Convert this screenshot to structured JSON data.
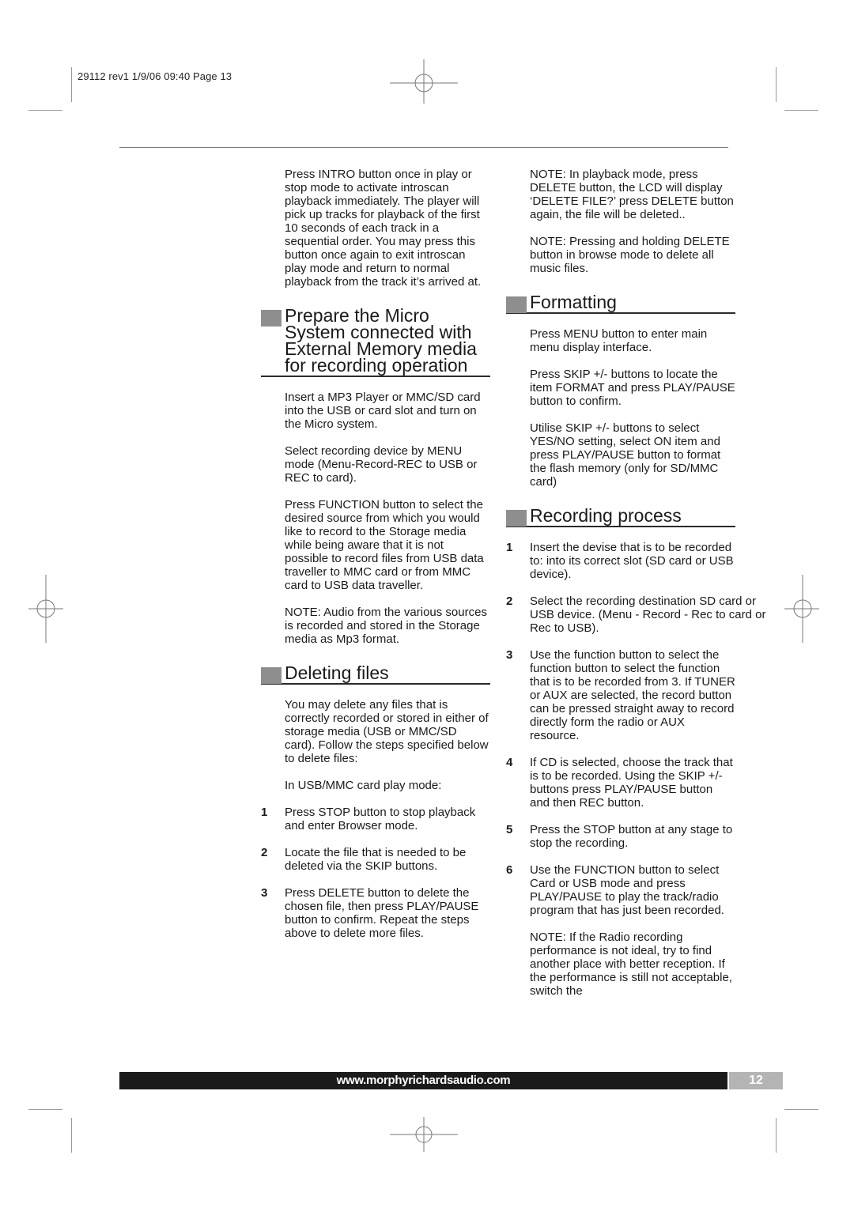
{
  "slug": "29112 rev1  1/9/06  09:40  Page 13",
  "colors": {
    "heading_square": "#8e8e8e",
    "footer_bar": "#1b1b1b",
    "footer_page_box": "#b4b4b4"
  },
  "left_column": {
    "intro_paragraph": "Press INTRO button once in play or stop mode to activate introscan playback immediately. The player will pick up tracks for playback of the first 10 seconds of each track in a sequential order. You may press this button once again to exit introscan play mode and return to normal playback from the track it’s arrived at.",
    "prepare_section": {
      "heading": "Prepare the Micro System connected with External Memory media for recording operation",
      "paragraphs": [
        "Insert a MP3 Player or MMC/SD card into the USB or card slot and turn on the Micro system.",
        "Select recording device by MENU mode (Menu-Record-REC to USB or REC to card).",
        "Press FUNCTION button to select the desired source from which you would like to record to the Storage media  while being aware that it is not possible to record files from USB data traveller to MMC card or from MMC card to USB data traveller.",
        "NOTE: Audio from the various sources is recorded and stored in the Storage media as Mp3 format."
      ]
    },
    "deleting_section": {
      "heading": "Deleting files",
      "paragraphs": [
        "You may delete any files that is correctly recorded or stored in either of storage media (USB or MMC/SD card). Follow  the steps specified below to delete files:",
        "In USB/MMC card play mode:"
      ],
      "steps": [
        {
          "num": "1",
          "text": "Press STOP button to stop playback and enter Browser mode."
        },
        {
          "num": "2",
          "text": "Locate the file that is needed to be deleted via the  SKIP buttons."
        },
        {
          "num": "3",
          "text": "Press DELETE button to delete the chosen file, then press PLAY/PAUSE button to confirm. Repeat the steps above to delete more files."
        }
      ]
    }
  },
  "right_column": {
    "notes": [
      "NOTE: In playback mode, press DELETE button, the LCD will display ‘DELETE FILE?’ press DELETE button again, the file will be deleted..",
      "NOTE: Pressing and holding DELETE button in browse mode to delete all music files."
    ],
    "formatting_section": {
      "heading": "Formatting",
      "paragraphs": [
        "Press MENU button to enter main menu display interface.",
        "Press SKIP +/- buttons to locate the item FORMAT and press PLAY/PAUSE button to confirm.",
        "Utilise SKIP +/- buttons to select YES/NO setting, select ON item and press PLAY/PAUSE button to format the flash memory (only for SD/MMC card)"
      ]
    },
    "recording_section": {
      "heading": "Recording process",
      "steps": [
        {
          "num": "1",
          "text": "Insert the devise that is to be recorded to: into its correct slot (SD card or USB device)."
        },
        {
          "num": "2",
          "text": "Select the recording destination SD card or USB device. (Menu - Record - Rec to card  or Rec to USB)."
        },
        {
          "num": "3",
          "text": "Use the function button to select the function button to select the function that is to be recorded from 3. If TUNER or AUX are selected, the record button can be pressed straight away to record directly form the radio or AUX resource."
        },
        {
          "num": "4",
          "text": "If CD is selected, choose the track that is to be recorded. Using the SKIP +/- buttons press PLAY/PAUSE button and then REC button."
        },
        {
          "num": "5",
          "text": "Press the STOP button at any stage to stop the recording."
        },
        {
          "num": "6",
          "text": "Use the FUNCTION button to select Card or USB mode and press PLAY/PAUSE to play the track/radio program that has just been recorded."
        }
      ],
      "closing_note": "NOTE: If the Radio recording performance is not ideal, try to find another place with better reception. If the performance is still not acceptable, switch the"
    }
  },
  "footer": {
    "url": "www.morphyrichardsaudio.com",
    "page_number": "12"
  }
}
